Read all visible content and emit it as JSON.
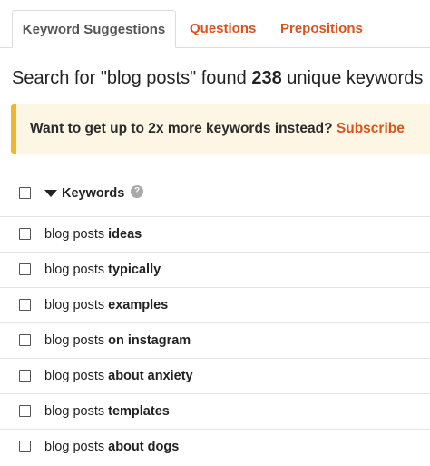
{
  "tabs": [
    {
      "label": "Keyword Suggestions",
      "active": true
    },
    {
      "label": "Questions",
      "active": false
    },
    {
      "label": "Prepositions",
      "active": false
    }
  ],
  "summary": {
    "prefix": "Search for \"blog posts\" found ",
    "count": "238",
    "suffix": " unique keywords"
  },
  "banner": {
    "text": "Want to get up to 2x more keywords instead? ",
    "link": "Subscribe"
  },
  "table": {
    "header": "Keywords",
    "help": "?",
    "rows": [
      {
        "base": "blog posts ",
        "suffix": "ideas"
      },
      {
        "base": "blog posts ",
        "suffix": "typically"
      },
      {
        "base": "blog posts ",
        "suffix": "examples"
      },
      {
        "base": "blog posts ",
        "suffix": "on instagram"
      },
      {
        "base": "blog posts ",
        "suffix": "about anxiety"
      },
      {
        "base": "blog posts ",
        "suffix": "templates"
      },
      {
        "base": "blog posts ",
        "suffix": "about dogs"
      }
    ]
  },
  "colors": {
    "accent": "#d9531e",
    "banner_bg": "#fdf6e4",
    "banner_border": "#f0b62d"
  }
}
